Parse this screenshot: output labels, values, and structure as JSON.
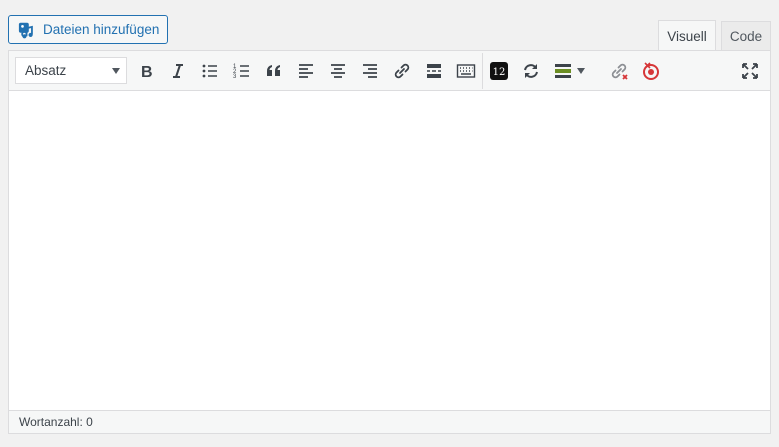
{
  "media": {
    "add_label": "Dateien hinzufügen"
  },
  "tabs": {
    "visual": "Visuell",
    "code": "Code"
  },
  "toolbar": {
    "format_value": "Absatz",
    "counter_badge": "12"
  },
  "status": {
    "word_count": "Wortanzahl: 0"
  },
  "colors": {
    "accent": "#2271b1",
    "border": "#dcdcde",
    "icon": "#3c434a",
    "alert": "#d63638"
  }
}
